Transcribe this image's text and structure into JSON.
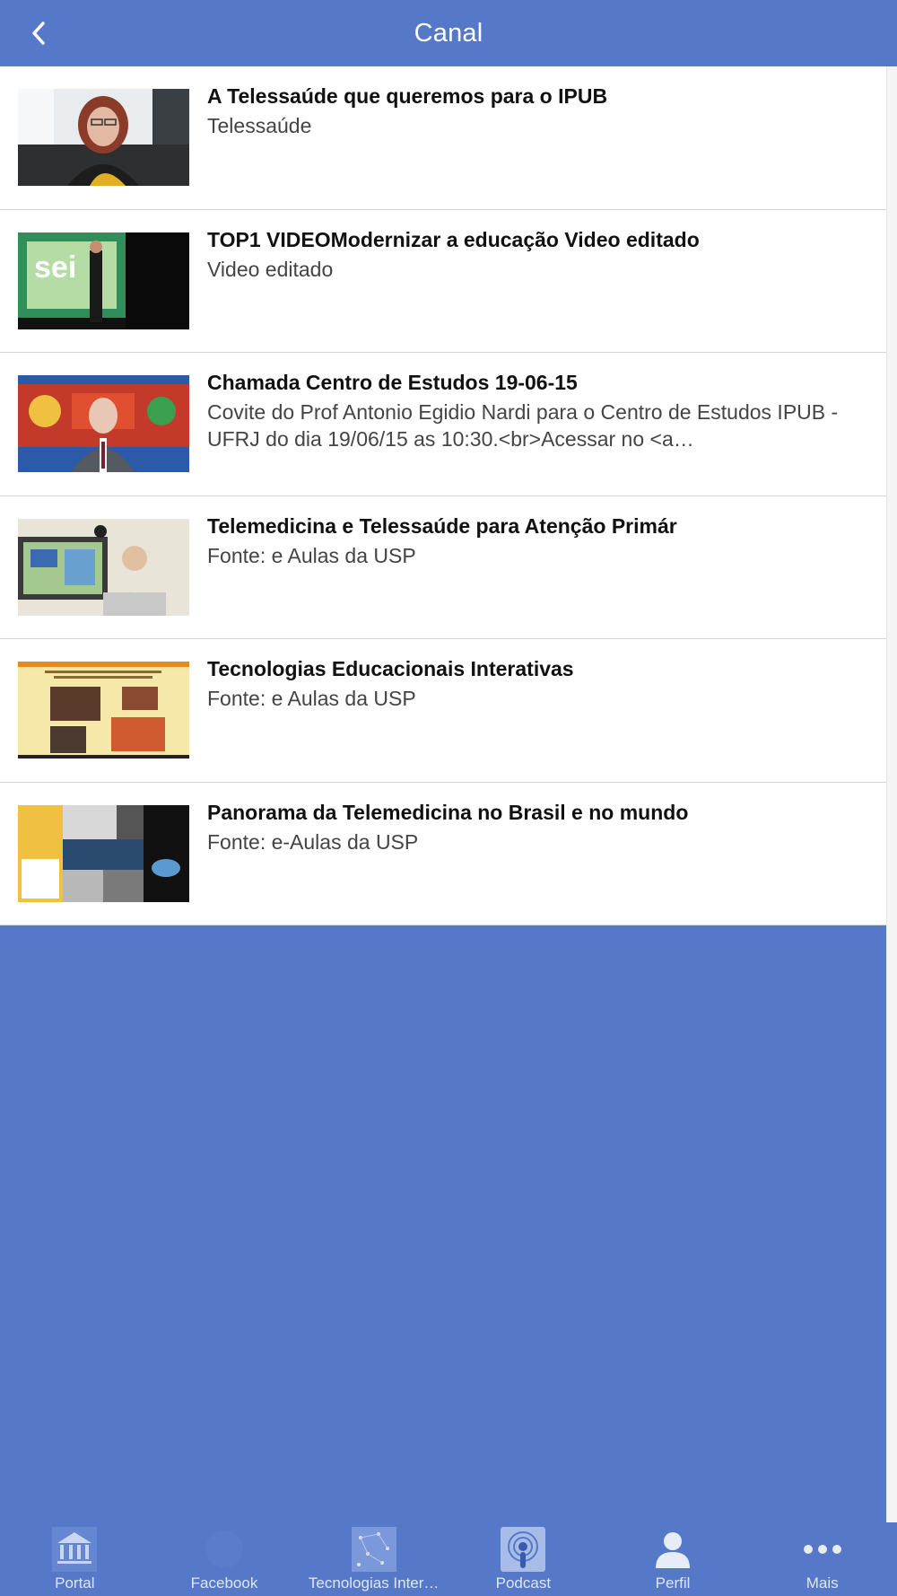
{
  "header": {
    "title": "Canal"
  },
  "items": [
    {
      "title": "A Telessaúde que queremos para o IPUB",
      "subtitle": "Telessaúde"
    },
    {
      "title": "TOP1 VIDEOModernizar a educação Video editado",
      "subtitle": "Video editado"
    },
    {
      "title": "Chamada Centro de Estudos 19-06-15",
      "subtitle": "Covite do Prof Antonio Egidio Nardi para o Centro de Estudos IPUB - UFRJ do dia 19/06/15 as 10:30.<br>Acessar no <a…"
    },
    {
      "title": "Telemedicina e Telessaúde para Atenção Primár",
      "subtitle": "Fonte: e Aulas da USP"
    },
    {
      "title": "Tecnologias Educacionais Interativas",
      "subtitle": "Fonte: e Aulas da USP"
    },
    {
      "title": "Panorama da Telemedicina no Brasil e no mundo",
      "subtitle": "Fonte: e-Aulas da USP"
    }
  ],
  "tabs": [
    {
      "label": "Portal",
      "icon": "portal-logo-icon"
    },
    {
      "label": "Facebook",
      "icon": "facebook-icon"
    },
    {
      "label": "Tecnologias Inter…",
      "icon": "tecnologias-icon"
    },
    {
      "label": "Podcast",
      "icon": "podcast-icon"
    },
    {
      "label": "Perfil",
      "icon": "profile-icon"
    },
    {
      "label": "Mais",
      "icon": "more-icon"
    }
  ],
  "colors": {
    "brand_blue": "#5578c9",
    "list_bg": "#ffffff",
    "divider": "#d3d3d3"
  }
}
